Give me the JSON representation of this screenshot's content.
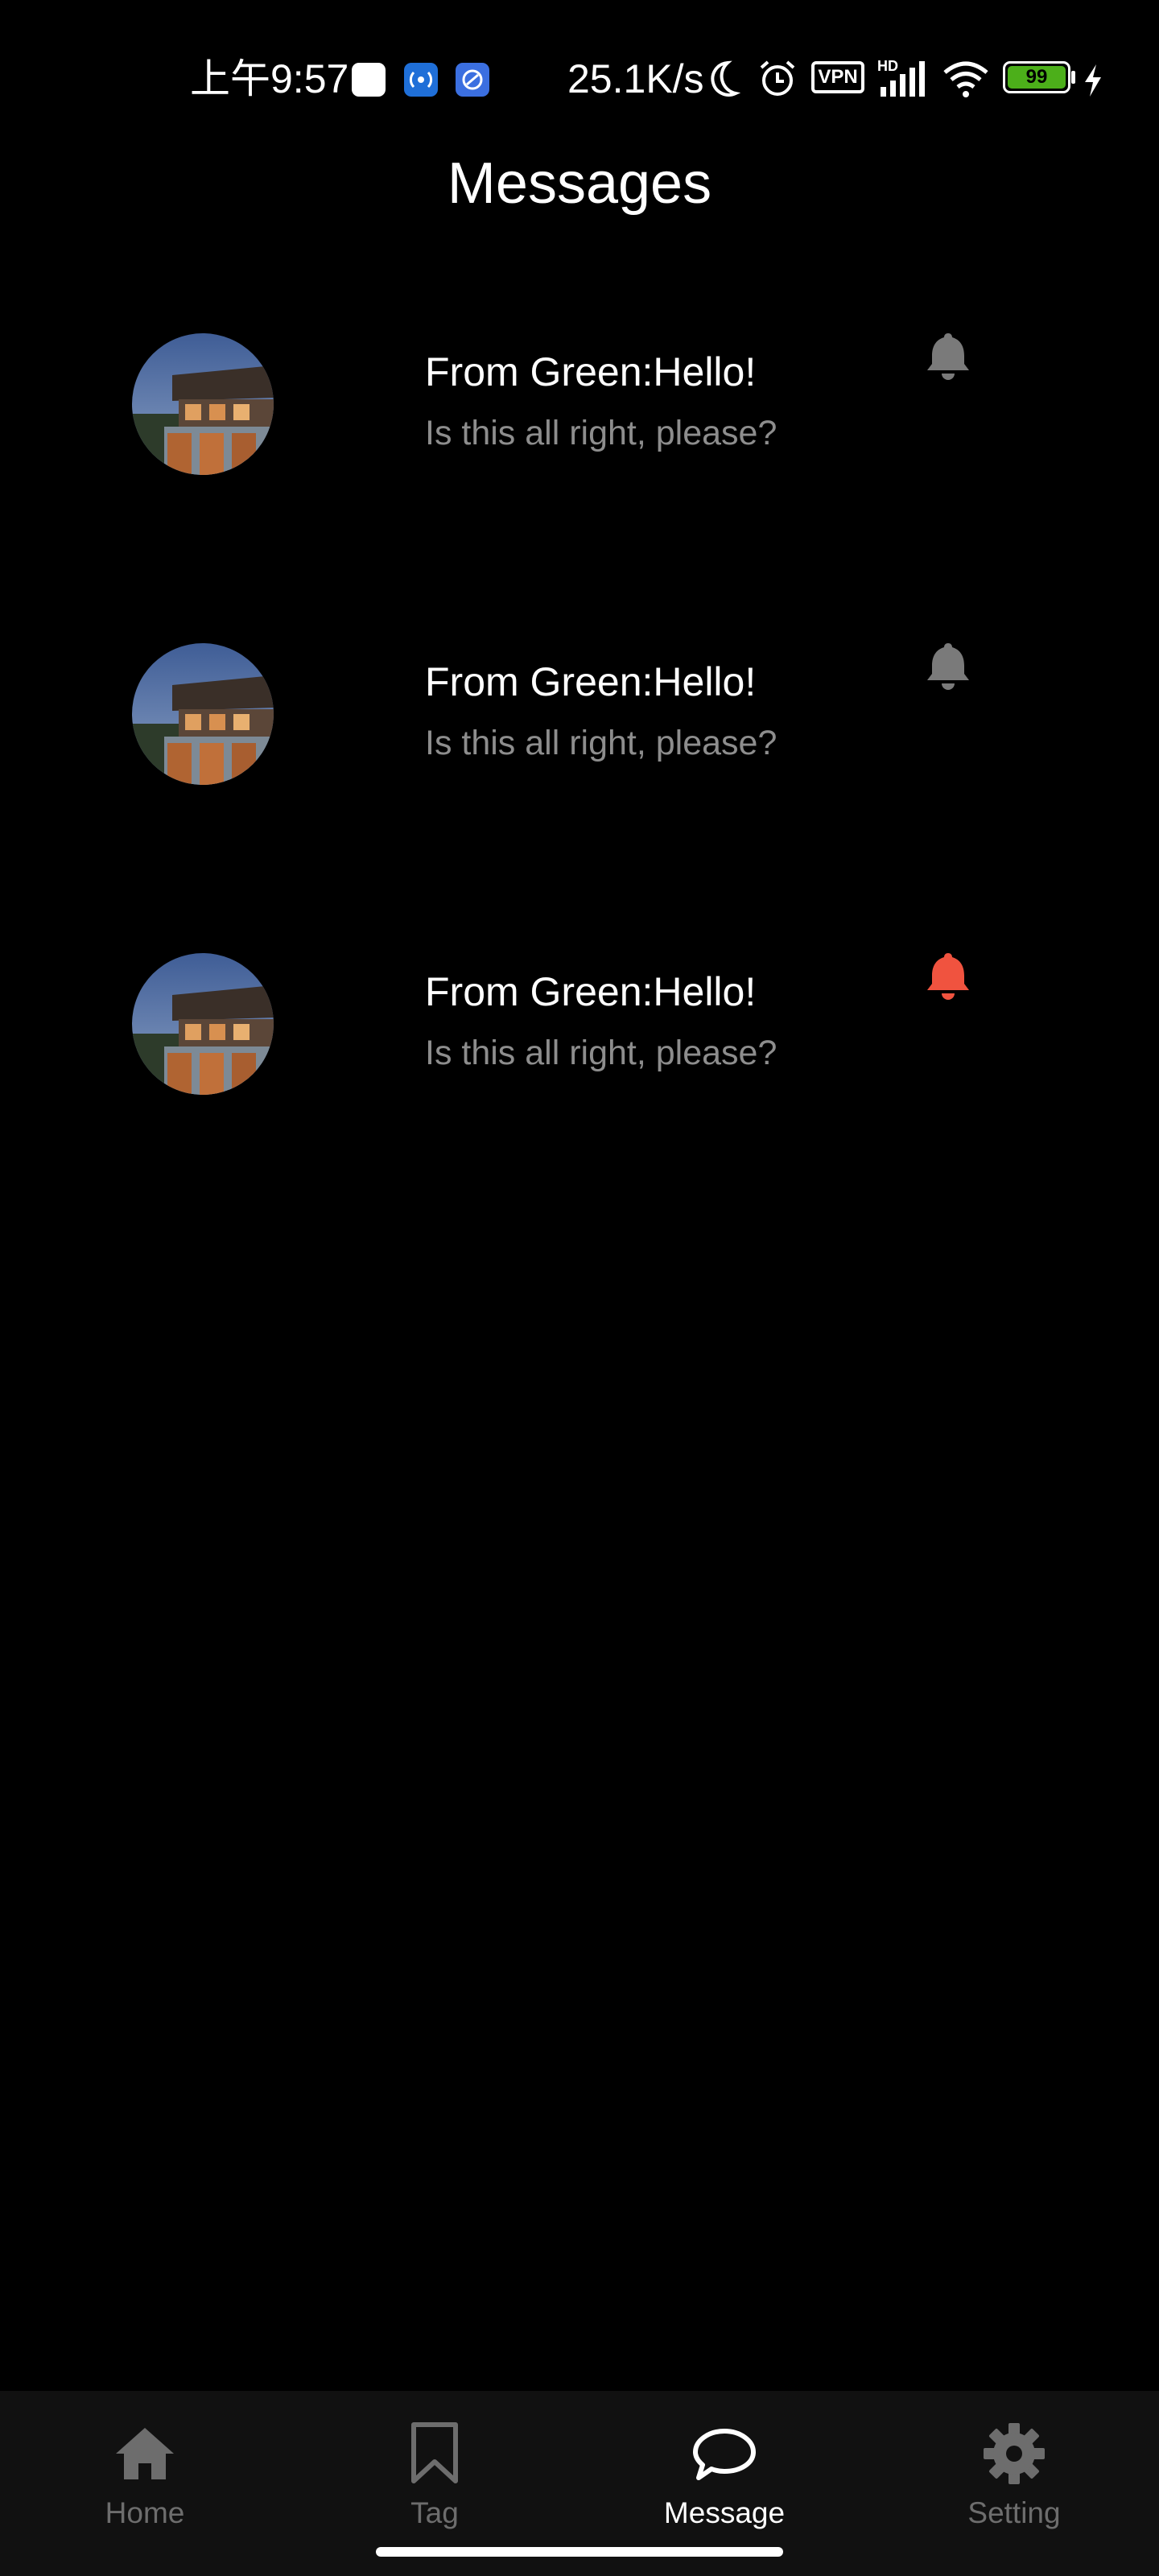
{
  "status_bar": {
    "time": "上午9:57",
    "network_speed": "25.1K/s",
    "vpn_label": "VPN",
    "signal_label": "HD",
    "battery_level": "99",
    "icons": [
      "notification-app-icon",
      "hotspot-icon",
      "link-app-icon",
      "moon-icon",
      "alarm-icon",
      "vpn-icon",
      "signal-icon",
      "wifi-icon",
      "battery-icon",
      "charging-icon"
    ]
  },
  "header": {
    "title": "Messages"
  },
  "messages": [
    {
      "title": "From Green:Hello!",
      "subtitle": "Is this all right, please?",
      "bell_color": "#7a7a7a",
      "bell_icon": "bell-icon"
    },
    {
      "title": "From Green:Hello!",
      "subtitle": "Is this all right, please?",
      "bell_color": "#7a7a7a",
      "bell_icon": "bell-icon"
    },
    {
      "title": "From Green:Hello!",
      "subtitle": "Is this all right, please?",
      "bell_color": "#f0533f",
      "bell_icon": "bell-icon"
    }
  ],
  "tab_bar": {
    "active": "Message",
    "tabs": [
      {
        "label": "Home",
        "icon": "home-icon"
      },
      {
        "label": "Tag",
        "icon": "bookmark-icon"
      },
      {
        "label": "Message",
        "icon": "chat-bubble-icon"
      },
      {
        "label": "Setting",
        "icon": "gear-icon"
      }
    ]
  },
  "colors": {
    "background": "#000000",
    "text_primary": "#ffffff",
    "text_secondary": "#8d8d8d",
    "tab_inactive": "#6d6d6d",
    "tab_bar_background": "#111111",
    "bell_muted": "#7a7a7a",
    "bell_alert": "#f0533f",
    "battery_fill": "#4caf1a"
  }
}
